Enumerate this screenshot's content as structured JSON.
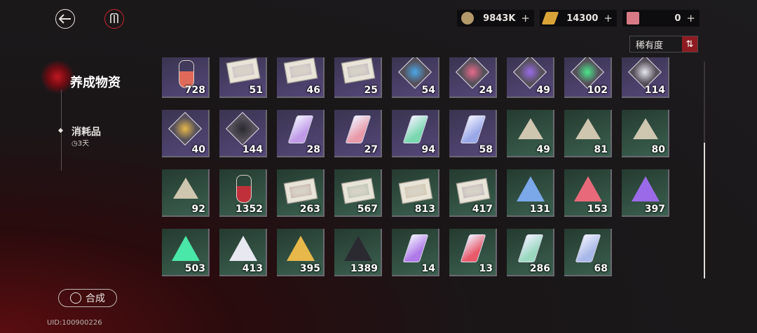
{
  "header": {
    "currencies": [
      {
        "value": "9843K",
        "plus": "+",
        "color": "#b49a6a",
        "icon": "coin-icon"
      },
      {
        "value": "14300",
        "plus": "+",
        "color": "#d9a338",
        "icon": "gold-bar-icon"
      },
      {
        "value": "0",
        "plus": "+",
        "color": "#d97b86",
        "icon": "eraser-icon"
      }
    ],
    "sort_label": "稀有度",
    "sort_arrow": "⇅"
  },
  "sidebar": {
    "title": "养成物资",
    "sub_label": "消耗品",
    "sub_timer": "3天"
  },
  "footer": {
    "synth_label": "合成",
    "uid": "UID:100900226"
  },
  "items": [
    [
      {
        "kind": "bottle",
        "rarity": "purple",
        "color": "#e06a5a",
        "qty": "728"
      },
      {
        "kind": "env",
        "rarity": "purple",
        "color": "#b08ad0",
        "qty": "51"
      },
      {
        "kind": "env",
        "rarity": "purple",
        "color": "#a07ac0",
        "qty": "46"
      },
      {
        "kind": "env",
        "rarity": "purple",
        "color": "#8a6ab0",
        "qty": "25"
      },
      {
        "kind": "gem",
        "rarity": "purple",
        "color": "#4aa8e8",
        "qty": "54"
      },
      {
        "kind": "gem",
        "rarity": "purple",
        "color": "#e86a8a",
        "qty": "24"
      },
      {
        "kind": "gem",
        "rarity": "purple",
        "color": "#9a6ae8",
        "qty": "49"
      },
      {
        "kind": "gem",
        "rarity": "purple",
        "color": "#4ae88a",
        "qty": "102"
      },
      {
        "kind": "gem",
        "rarity": "purple",
        "color": "#e8e8f0",
        "qty": "114"
      }
    ],
    [
      {
        "kind": "gem",
        "rarity": "purple",
        "color": "#e8b84a",
        "qty": "40"
      },
      {
        "kind": "gem",
        "rarity": "purple",
        "color": "#2a2a30",
        "qty": "144"
      },
      {
        "kind": "shard",
        "rarity": "purple",
        "color": "#c09ae8",
        "qty": "28"
      },
      {
        "kind": "shard",
        "rarity": "purple",
        "color": "#e89aa8",
        "qty": "27"
      },
      {
        "kind": "shard",
        "rarity": "purple",
        "color": "#7ad8b0",
        "qty": "94"
      },
      {
        "kind": "shard",
        "rarity": "purple",
        "color": "#9aa8e8",
        "qty": "58"
      },
      {
        "kind": "emblem",
        "rarity": "green",
        "color": "#cfc6b0",
        "qty": "49"
      },
      {
        "kind": "emblem",
        "rarity": "green",
        "color": "#cfc6b0",
        "qty": "81"
      },
      {
        "kind": "emblem",
        "rarity": "green",
        "color": "#cfc6b0",
        "qty": "80"
      }
    ],
    [
      {
        "kind": "emblem",
        "rarity": "green",
        "color": "#cfc6b0",
        "qty": "92"
      },
      {
        "kind": "bottle",
        "rarity": "green",
        "color": "#c0303a",
        "qty": "1352"
      },
      {
        "kind": "env",
        "rarity": "green",
        "color": "#a05050",
        "qty": "263"
      },
      {
        "kind": "env",
        "rarity": "green",
        "color": "#5a9a6a",
        "qty": "567"
      },
      {
        "kind": "env",
        "rarity": "green",
        "color": "#d09a5a",
        "qty": "813"
      },
      {
        "kind": "env",
        "rarity": "green",
        "color": "#8a5aa0",
        "qty": "417"
      },
      {
        "kind": "tri",
        "rarity": "green",
        "color": "#7aa8e8",
        "qty": "131"
      },
      {
        "kind": "tri",
        "rarity": "green",
        "color": "#e86a7a",
        "qty": "153"
      },
      {
        "kind": "tri",
        "rarity": "green",
        "color": "#9a6ae8",
        "qty": "397"
      }
    ],
    [
      {
        "kind": "tri",
        "rarity": "green",
        "color": "#4ae8a8",
        "qty": "503"
      },
      {
        "kind": "tri",
        "rarity": "green",
        "color": "#e8e8f0",
        "qty": "413"
      },
      {
        "kind": "tri",
        "rarity": "green",
        "color": "#e8b84a",
        "qty": "395"
      },
      {
        "kind": "tri",
        "rarity": "green",
        "color": "#2a2a30",
        "qty": "1389"
      },
      {
        "kind": "shard",
        "rarity": "green",
        "color": "#b07ae8",
        "qty": "14"
      },
      {
        "kind": "shard",
        "rarity": "green",
        "color": "#e85a6a",
        "qty": "13"
      },
      {
        "kind": "shard",
        "rarity": "green",
        "color": "#9ad8c0",
        "qty": "286"
      },
      {
        "kind": "shard",
        "rarity": "green",
        "color": "#a8b8e8",
        "qty": "68"
      }
    ]
  ]
}
